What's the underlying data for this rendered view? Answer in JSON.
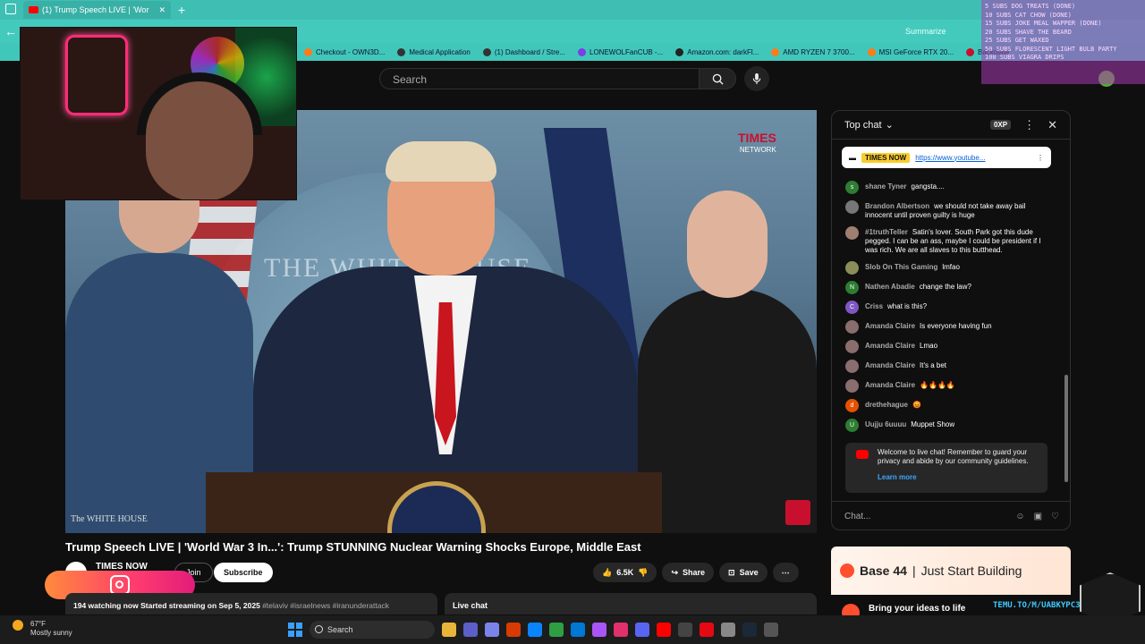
{
  "browser": {
    "tab_title": "(1) Trump Speech LIVE | 'Wor",
    "new_tab": "+",
    "summarize": "Summarize",
    "bookmarks": [
      {
        "label": "Checkout - OWN3D...",
        "color": "#ff7a1a"
      },
      {
        "label": "Medical Application",
        "color": "#333333"
      },
      {
        "label": "(1) Dashboard / Stre...",
        "color": "#333333"
      },
      {
        "label": "LONEWOLFanCUB -...",
        "color": "#7b3fe4"
      },
      {
        "label": "Amazon.com: darkFl...",
        "color": "#222222"
      },
      {
        "label": "AMD RYZEN 7 3700...",
        "color": "#ff7a1a"
      },
      {
        "label": "MSI GeForce RTX 20...",
        "color": "#ff7a1a"
      },
      {
        "label": "Backplate",
        "color": "#c8102e"
      }
    ]
  },
  "youtube": {
    "search_placeholder": "Search",
    "video_title": "Trump Speech LIVE | 'World War 3 In...': Trump STUNNING Nuclear Warning Shocks Europe, Middle East",
    "channel_name": "TIMES NOW",
    "join_label": "Join",
    "subscribe_label": "Subscribe",
    "like_count": "6.5K",
    "share_label": "Share",
    "save_label": "Save",
    "watching": "194 watching now",
    "started": "Started streaming on Sep 5, 2025",
    "tags": "#telaviv #israelnews #iranunderattack",
    "live_chat_tab": "Live chat",
    "video_overlay": {
      "whitehouse_text": "THE WHITE HOUSE",
      "whitehouse_tag": "The WHITE HOUSE",
      "network_logo": "TIMES",
      "network_sub": "NETWORK"
    }
  },
  "stream_overlay": {
    "subs_lines": [
      "5 SUBS DOG TREATS (DONE)",
      "10 SUBS CAT CHOW (DONE)",
      "15 SUBS JOKE MEAL WAPPER (DONE)",
      "20 SUBS SHAVE THE BEARD",
      "25 SUBS GET WAXED",
      "50 SUBS FLORESCENT LIGHT BULB PARTY",
      "100 SUBS VIAGRA DRIPS"
    ],
    "promo_url": "TEMU.TO/M/UABKYPC3J2P"
  },
  "chat": {
    "mode": "Top chat",
    "xp": "0XP",
    "pinned_channel": "TIMES NOW",
    "pinned_url": "https://www.youtube...",
    "messages": [
      {
        "initial": "s",
        "author": "shane Tyner",
        "text": "gangsta....",
        "color": "#2e7d32"
      },
      {
        "initial": "",
        "author": "Brandon Albertson",
        "text": "we should not take away bail innocent until proven guilty is huge",
        "color": "#777777"
      },
      {
        "initial": "",
        "author": "#1truthTeller",
        "text": "Satin's lover. South Park got this dude pegged. I can be an ass, maybe I could be president if I was rich. We are all slaves to this butthead.",
        "color": "#9e7f72"
      },
      {
        "initial": "",
        "author": "Slob On This Gaming",
        "text": "lmfao",
        "color": "#8d8d5a"
      },
      {
        "initial": "N",
        "author": "Nathen Abadie",
        "text": "change the law?",
        "color": "#2e7d32"
      },
      {
        "initial": "C",
        "author": "Criss",
        "text": "what is this?",
        "color": "#7e57c2"
      },
      {
        "initial": "",
        "author": "Amanda Claire",
        "text": "Is everyone having fun",
        "color": "#8a6d6d"
      },
      {
        "initial": "",
        "author": "Amanda Claire",
        "text": "Lmao",
        "color": "#8a6d6d"
      },
      {
        "initial": "",
        "author": "Amanda Claire",
        "text": "It's a bet",
        "color": "#8a6d6d"
      },
      {
        "initial": "",
        "author": "Amanda Claire",
        "text": "🔥🔥🔥🔥",
        "color": "#8a6d6d"
      },
      {
        "initial": "d",
        "author": "drethehague",
        "text": "😡",
        "color": "#e65100"
      },
      {
        "initial": "U",
        "author": "Uujju 6uuuu",
        "text": "Muppet Show",
        "color": "#2e7d32"
      }
    ],
    "welcome_text": "Welcome to live chat! Remember to guard your privacy and abide by our community guidelines.",
    "learn_more": "Learn more",
    "input_placeholder": "Chat..."
  },
  "ads": {
    "brand": "Base 44",
    "tagline": "Just Start Building",
    "line2": "Bring your ideas to life"
  },
  "taskbar": {
    "temp": "67°F",
    "condition": "Mostly sunny",
    "search_label": "Search",
    "icon_colors": [
      "#e8b43a",
      "#5b5fc7",
      "#7b83eb",
      "#d83b01",
      "#0a84ff",
      "#2ea043",
      "#0078d4",
      "#a855f7",
      "#e1306c",
      "#5865f2",
      "#ff0000",
      "#444444",
      "#e50914",
      "#888888",
      "#1b2838",
      "#555555"
    ]
  }
}
